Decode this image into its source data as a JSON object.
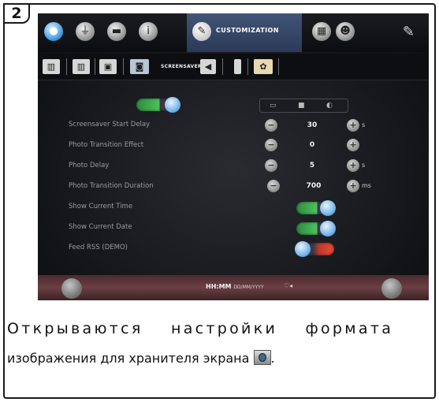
{
  "step": {
    "number": "2"
  },
  "screen": {
    "topbar": {
      "active_tab_label": "CUSTOMIZATION"
    },
    "subbar": {
      "active_tab_label": "SCREENSAVER"
    },
    "mode_buttons": [
      "▭",
      "■",
      "◐"
    ],
    "rows": [
      {
        "label": "Screensaver Start Delay",
        "type": "stepper",
        "value": "30",
        "unit": "s"
      },
      {
        "label": "Photo Transition Effect",
        "type": "stepper",
        "value": "0",
        "unit": ""
      },
      {
        "label": "Photo Delay",
        "type": "stepper",
        "value": "5",
        "unit": "s"
      },
      {
        "label": "Photo Transition Duration",
        "type": "stepper",
        "value": "700",
        "unit": "ms"
      },
      {
        "label": "Show Current Time",
        "type": "toggle",
        "state": "on"
      },
      {
        "label": "Show Current Date",
        "type": "toggle",
        "state": "on"
      },
      {
        "label": "Feed RSS (DEMO)",
        "type": "toggle",
        "state": "off"
      }
    ],
    "bottombar": {
      "time_format": "HH:MM",
      "date_format": "DD/MM/YYYY",
      "extra": "♡◂"
    },
    "icons": {
      "wrench": "wrench-icon",
      "accent_color": "#4dc25e",
      "active_tab_color": "#2a3a57"
    }
  },
  "caption": {
    "line1": "Открываются настройки формата",
    "line2": "изображения для хранителя экрана",
    "line2_end": "."
  }
}
